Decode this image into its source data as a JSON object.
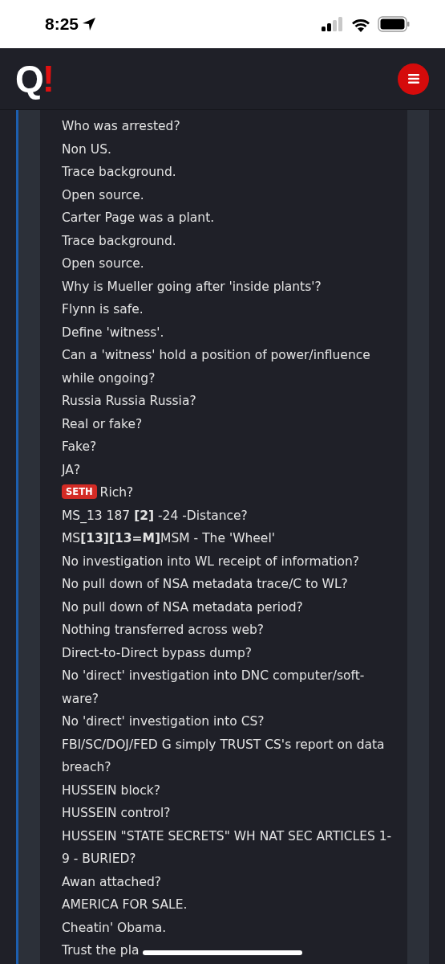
{
  "status_bar": {
    "time": "8:25"
  },
  "header": {
    "logo": {
      "letter": "Q",
      "mark": "!"
    }
  },
  "post": {
    "lines": [
      {
        "kind": "text",
        "text": "Who was arrested?"
      },
      {
        "kind": "text",
        "text": "Non US."
      },
      {
        "kind": "text",
        "text": "Trace background."
      },
      {
        "kind": "text",
        "text": "Open source."
      },
      {
        "kind": "text",
        "text": "Carter Page was a plant."
      },
      {
        "kind": "text",
        "text": "Trace background."
      },
      {
        "kind": "text",
        "text": "Open source."
      },
      {
        "kind": "text",
        "text": "Why is Mueller going after 'inside plants'?"
      },
      {
        "kind": "text",
        "text": "Flynn is safe."
      },
      {
        "kind": "text",
        "text": "Define 'witness'."
      },
      {
        "kind": "text",
        "text": "Can a 'witness' hold a position of power/influence while ongoing?"
      },
      {
        "kind": "text",
        "text": "Russia Russia Russia?"
      },
      {
        "kind": "text",
        "text": "Real or fake?"
      },
      {
        "kind": "text",
        "text": "Fake?"
      },
      {
        "kind": "text",
        "text": "JA?"
      },
      {
        "kind": "tagged",
        "tag": "SETH",
        "text": "Rich?"
      },
      {
        "kind": "text",
        "text": "MS_13 187 **[2]** -24 -Distance?"
      },
      {
        "kind": "text",
        "text": "MS**[13][13=M]**MSM - The 'Wheel'"
      },
      {
        "kind": "text",
        "text": "No investigation into WL receipt of information?"
      },
      {
        "kind": "text",
        "text": "No pull down of NSA metadata trace/C to WL?"
      },
      {
        "kind": "text",
        "text": "No pull down of NSA metadata period?"
      },
      {
        "kind": "text",
        "text": "Nothing transferred across web?"
      },
      {
        "kind": "text",
        "text": "Direct-to-Direct bypass dump?"
      },
      {
        "kind": "text",
        "text": "No 'direct' investigation into DNC computer/soft-ware?"
      },
      {
        "kind": "text",
        "text": "No 'direct' investigation into CS?"
      },
      {
        "kind": "text",
        "text": "FBI/SC/DOJ/FED G simply TRUST CS's report on data breach?"
      },
      {
        "kind": "text",
        "text": "HUSSEIN block?"
      },
      {
        "kind": "text",
        "text": "HUSSEIN control?"
      },
      {
        "kind": "text",
        "text": "HUSSEIN \"STATE SECRETS\" WH NAT SEC ARTICLES 1-9 - BURIED?"
      },
      {
        "kind": "text",
        "text": "Awan attached?"
      },
      {
        "kind": "text",
        "text": "AMERICA FOR SALE."
      },
      {
        "kind": "text",
        "text": "Cheatin' Obama."
      },
      {
        "kind": "text",
        "text": "Trust the pla"
      }
    ]
  }
}
